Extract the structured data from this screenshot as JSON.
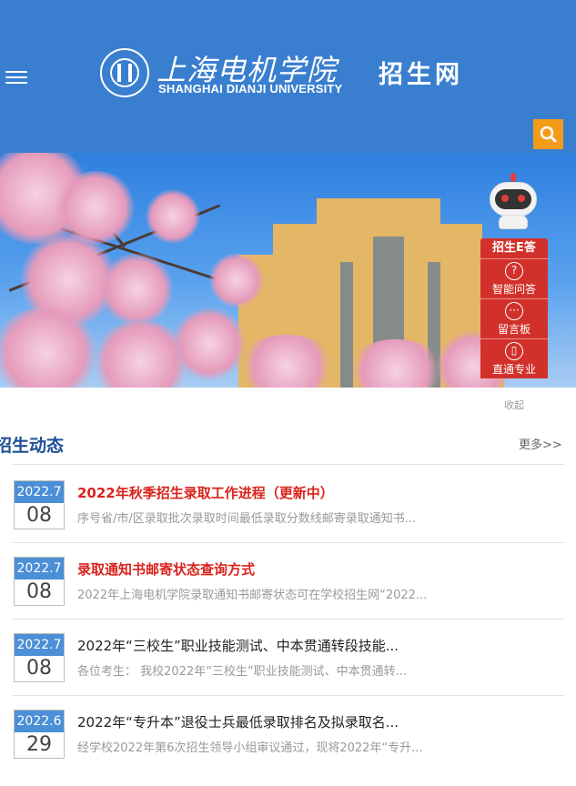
{
  "header": {
    "logo_cn": "上海电机学院",
    "logo_en": "SHANGHAI DIANJI UNIVERSITY",
    "site_title": "招生网",
    "bg_color": "#3a7fcf",
    "search_color": "#f39c19",
    "menu_icon": "hamburger-icon",
    "search_icon": "search-icon"
  },
  "ewidget": {
    "title": "招生E答",
    "items": [
      {
        "label": "智能问答",
        "icon": "question-icon"
      },
      {
        "label": "留言板",
        "icon": "message-icon"
      },
      {
        "label": "直通专业",
        "icon": "book-icon"
      }
    ],
    "collapse": "收起",
    "accent": "#d2312b"
  },
  "news_section": {
    "title": "招生动态",
    "more": "更多>>",
    "items": [
      {
        "ym": "2022.7",
        "day": "08",
        "title": "2022年秋季招生录取工作进程（更新中）",
        "summary": "序号省/市/区录取批次录取时间最低录取分数线邮寄录取通知书...",
        "highlight": true
      },
      {
        "ym": "2022.7",
        "day": "08",
        "title": "录取通知书邮寄状态查询方式",
        "summary": "2022年上海电机学院录取通知书邮寄状态可在学校招生网“2022...",
        "highlight": true
      },
      {
        "ym": "2022.7",
        "day": "08",
        "title": "2022年“三校生”职业技能测试、中本贯通转段技能...",
        "summary": "各位考生：  我校2022年“三校生”职业技能测试、中本贯通转...",
        "highlight": false
      },
      {
        "ym": "2022.6",
        "day": "29",
        "title": "2022年“专升本”退役士兵最低录取排名及拟录取名...",
        "summary": "经学校2022年第6次招生领导小组审议通过，现将2022年“专升...",
        "highlight": false
      }
    ]
  }
}
